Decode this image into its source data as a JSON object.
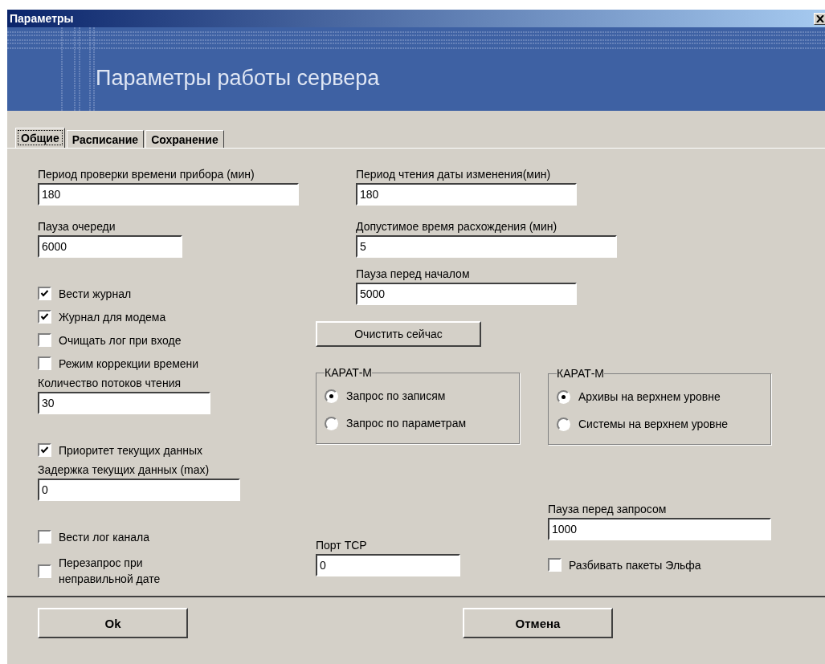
{
  "window": {
    "title": "Параметры"
  },
  "banner": {
    "title": "Параметры работы сервера"
  },
  "tabs": [
    {
      "label": "Общие",
      "selected": true
    },
    {
      "label": "Расписание",
      "selected": false
    },
    {
      "label": "Сохранение",
      "selected": false
    }
  ],
  "left": [
    {
      "kind": "field",
      "label": "Период проверки времени прибора (мин)",
      "value": "180"
    },
    {
      "kind": "field",
      "label": "Пауза очереди",
      "value": "6000"
    },
    {
      "kind": "checkbox",
      "label": "Вести журнал",
      "checked": true
    },
    {
      "kind": "checkbox",
      "label": "Журнал для модема",
      "checked": true
    },
    {
      "kind": "checkbox",
      "label": "Очищать лог при входе",
      "checked": false
    },
    {
      "kind": "checkbox",
      "label": "Режим коррекции времени",
      "checked": false
    },
    {
      "kind": "field",
      "label": "Количество потоков чтения",
      "value": "30"
    },
    {
      "kind": "checkbox",
      "label": "Приоритет текущих данных",
      "checked": true
    },
    {
      "kind": "field",
      "label": "Задержка текущих данных (max)",
      "value": "0"
    },
    {
      "kind": "checkbox",
      "label": "Вести лог канала",
      "checked": false
    },
    {
      "kind": "checkbox",
      "label": "Перезапрос при неправильной дате",
      "checked": false
    }
  ],
  "middle": [
    {
      "kind": "field",
      "label": "Период чтения даты изменения(мин)",
      "value": "180"
    },
    {
      "kind": "field",
      "label": "Допустимое время расхождения (мин)",
      "value": "5"
    },
    {
      "kind": "field",
      "label": "Пауза перед началом",
      "value": "5000"
    },
    {
      "kind": "button",
      "label": "Очистить сейчас"
    },
    {
      "kind": "group",
      "title": "КАРАТ-М",
      "options": [
        {
          "label": "Запрос по записям",
          "selected": true
        },
        {
          "label": "Запрос по параметрам",
          "selected": false
        }
      ]
    },
    {
      "kind": "field",
      "label": "Порт TCP",
      "value": "0"
    }
  ],
  "right": [
    {
      "kind": "group",
      "title": "КАРАТ-М",
      "options": [
        {
          "label": "Архивы на верхнем уровне",
          "selected": true
        },
        {
          "label": "Системы на верхнем уровне",
          "selected": false
        }
      ]
    },
    {
      "kind": "field",
      "label": "Пауза перед запросом",
      "value": "1000"
    },
    {
      "kind": "checkbox",
      "label": "Разбивать пакеты Эльфа",
      "checked": false
    }
  ],
  "buttons": [
    "Ok",
    "Отмена"
  ]
}
